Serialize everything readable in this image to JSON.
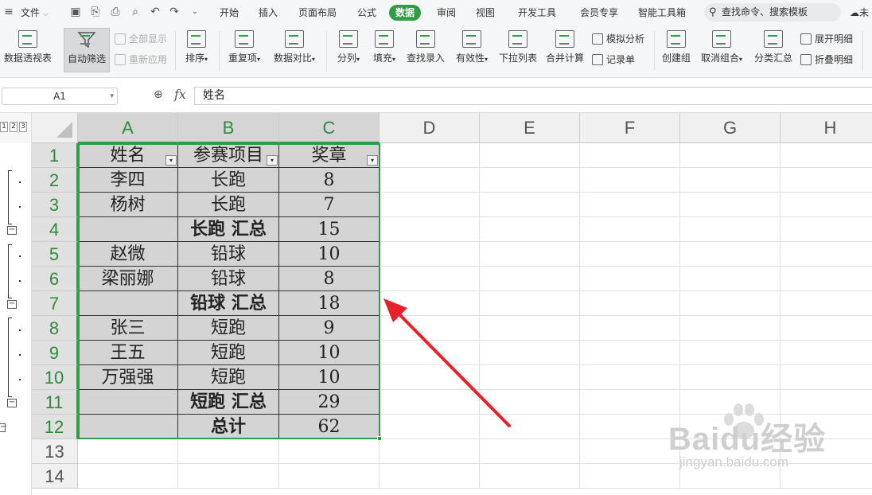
{
  "menubar": {
    "file": "文件",
    "tabs": [
      {
        "label": "开始"
      },
      {
        "label": "插入"
      },
      {
        "label": "页面布局"
      },
      {
        "label": "公式"
      },
      {
        "label": "数据",
        "active": true
      },
      {
        "label": "审阅"
      },
      {
        "label": "视图"
      },
      {
        "label": "开发工具"
      },
      {
        "label": "会员专享"
      },
      {
        "label": "智能工具箱"
      }
    ],
    "search_placeholder": "查找命令、搜索模板",
    "sync_label": "未"
  },
  "ribbon": {
    "pivot": "数据透视表",
    "autofilter": "自动筛选",
    "show_all": "全部显示",
    "reapply": "重新应用",
    "sort": "排序",
    "duplicates": "重复项",
    "compare": "数据对比",
    "split": "分列",
    "fill": "填充",
    "lookup": "查找录入",
    "validity": "有效性",
    "dropdown": "下拉列表",
    "consolidate": "合并计算",
    "whatif": "模拟分析",
    "record": "记录单",
    "group": "创建组",
    "ungroup": "取消组合",
    "subtotal": "分类汇总",
    "expand": "展开明细",
    "collapse": "折叠明细"
  },
  "formula_bar": {
    "cell_ref": "A1",
    "fx": "fx",
    "content": "姓名"
  },
  "outline_levels": [
    "1",
    "2",
    "3"
  ],
  "columns": [
    "A",
    "B",
    "C",
    "D",
    "E",
    "F",
    "G",
    "H"
  ],
  "rows": [
    {
      "num": "1",
      "a": "姓名",
      "b": "参赛项目",
      "c": "奖章"
    },
    {
      "num": "2",
      "a": "李四",
      "b": "长跑",
      "c": "8"
    },
    {
      "num": "3",
      "a": "杨树",
      "b": "长跑",
      "c": "7"
    },
    {
      "num": "4",
      "a": "",
      "b": "长跑 汇总",
      "c": "15"
    },
    {
      "num": "5",
      "a": "赵微",
      "b": "铅球",
      "c": "10"
    },
    {
      "num": "6",
      "a": "梁丽娜",
      "b": "铅球",
      "c": "8"
    },
    {
      "num": "7",
      "a": "",
      "b": "铅球 汇总",
      "c": "18"
    },
    {
      "num": "8",
      "a": "张三",
      "b": "短跑",
      "c": "9"
    },
    {
      "num": "9",
      "a": "王五",
      "b": "短跑",
      "c": "10"
    },
    {
      "num": "10",
      "a": "万强强",
      "b": "短跑",
      "c": "10"
    },
    {
      "num": "11",
      "a": "",
      "b": "短跑 汇总",
      "c": "29"
    },
    {
      "num": "12",
      "a": "",
      "b": "总计",
      "c": "62"
    },
    {
      "num": "13",
      "a": "",
      "b": "",
      "c": ""
    },
    {
      "num": "14",
      "a": "",
      "b": "",
      "c": ""
    }
  ],
  "colors": {
    "accent": "#2f9c46",
    "arrow": "#e8202a",
    "selection_fill": "#d4d4d4"
  },
  "watermark": {
    "brand": "Baidu经验",
    "url": "jingyan.baidu.com"
  }
}
